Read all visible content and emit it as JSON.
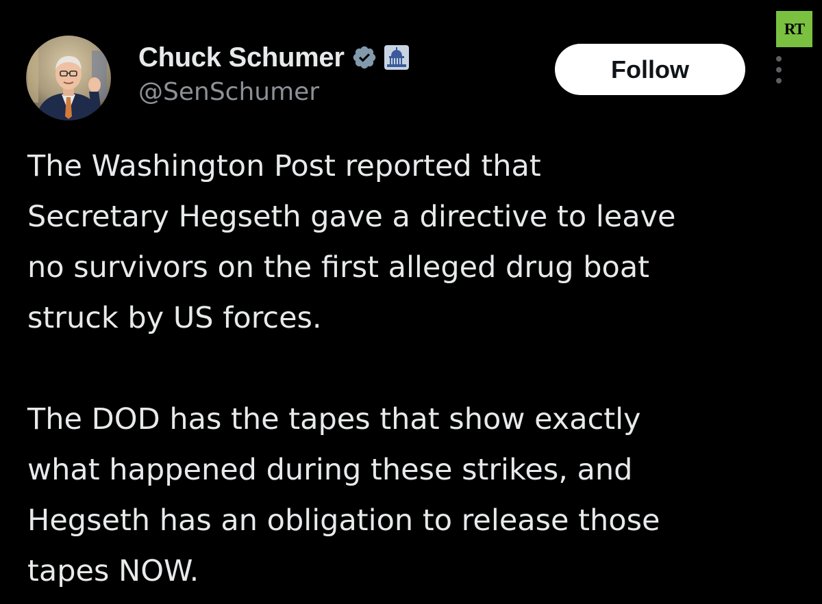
{
  "author": {
    "display_name": "Chuck Schumer",
    "handle": "@SenSchumer",
    "verified_icon": "verified-badge-icon",
    "affiliation_icon": "capitol-building-icon"
  },
  "actions": {
    "follow_label": "Follow",
    "more_icon": "more-options-icon"
  },
  "watermark": {
    "text": "RT",
    "color": "#7ac142"
  },
  "tweet": {
    "paragraphs": [
      {
        "lines": [
          "The Washington Post reported that",
          "Secretary Hegseth gave a directive to leave",
          "no survivors on the first alleged drug boat",
          "struck by US forces."
        ]
      },
      {
        "lines": [
          "The DOD has the tapes that show exactly",
          "what happened during these strikes, and",
          "Hegseth has an obligation to release those",
          "tapes NOW."
        ]
      }
    ]
  },
  "colors": {
    "background": "#000000",
    "text": "#e7e9ea",
    "secondary_text": "#8b9196",
    "verified_badge": "#829aab",
    "follow_button_bg": "#ffffff"
  }
}
